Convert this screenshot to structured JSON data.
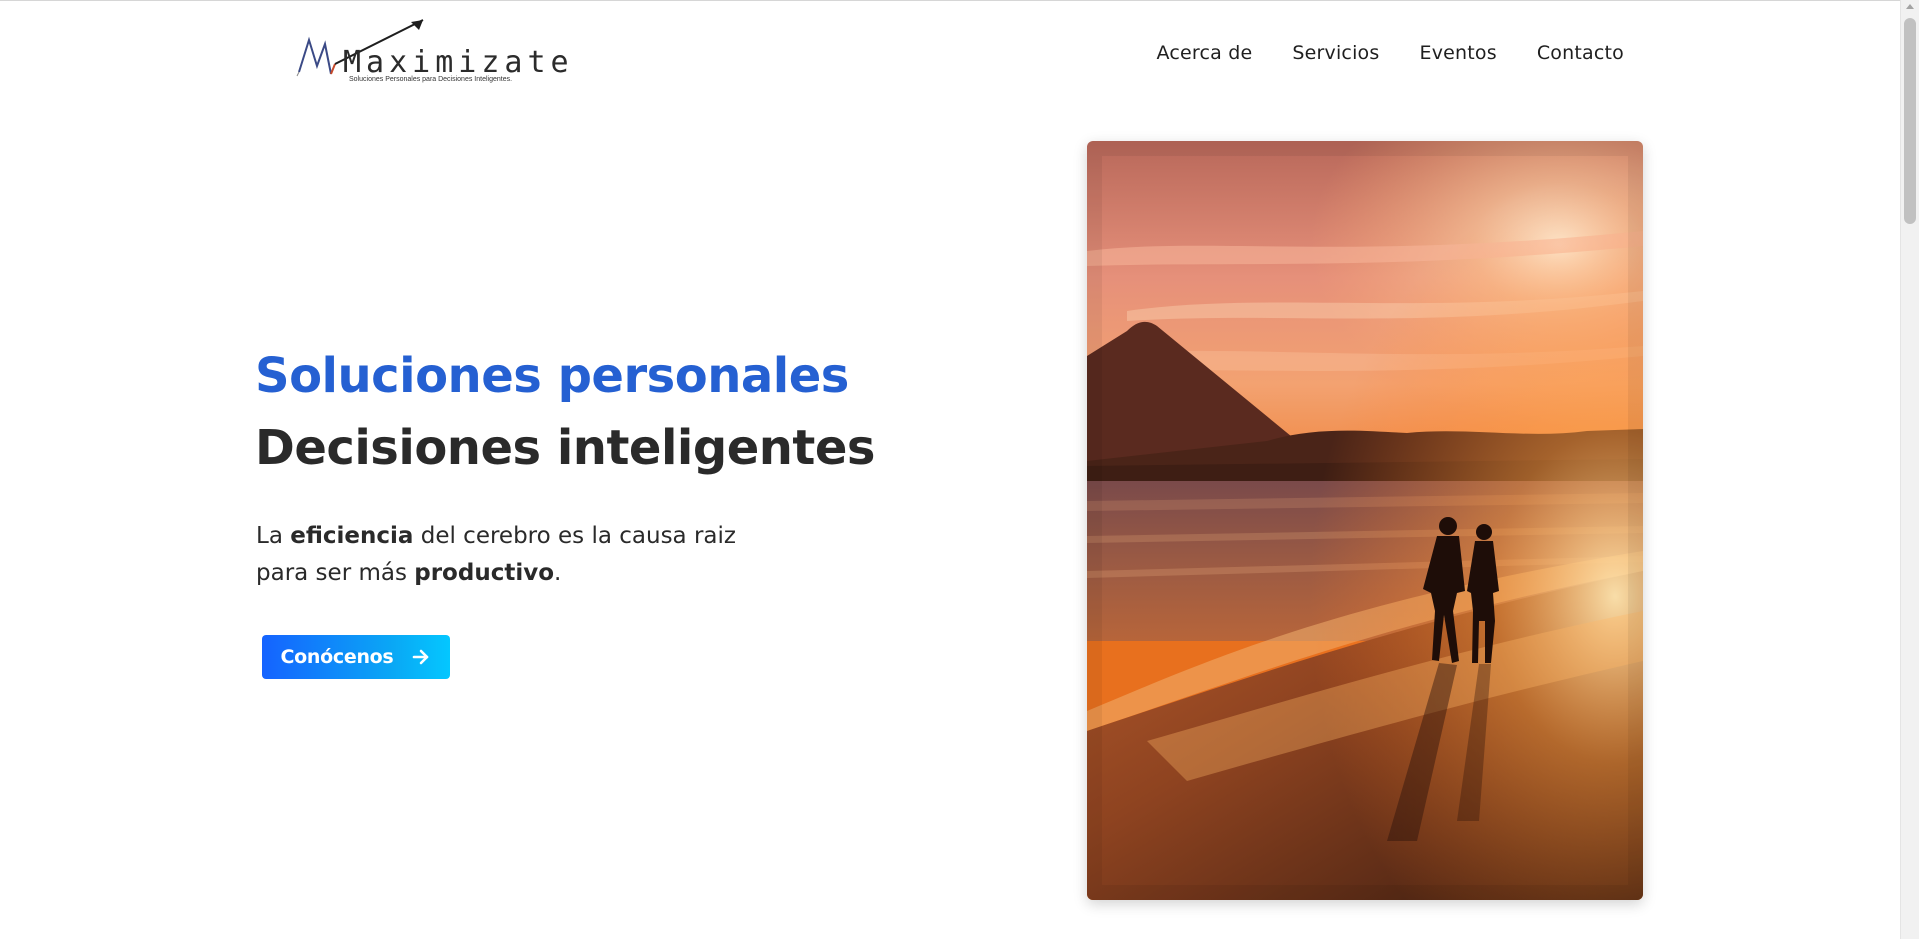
{
  "header": {
    "logo": {
      "wordmark": "Maximizate",
      "tagline": "Soluciones Personales para Decisiones Inteligentes."
    },
    "nav": [
      {
        "label": "Acerca de"
      },
      {
        "label": "Servicios"
      },
      {
        "label": "Eventos"
      },
      {
        "label": "Contacto"
      }
    ]
  },
  "hero": {
    "title_line1": "Soluciones personales",
    "title_line2": "Decisiones inteligentes",
    "paragraph": {
      "p1": "La ",
      "bold1": "eficiencia",
      "p2": " del cerebro es la causa raiz",
      "p3": "para ser más ",
      "bold2": "productivo",
      "p4": "."
    },
    "cta_label": "Conócenos",
    "cta_icon": "arrow-right-icon"
  },
  "colors": {
    "accent_blue": "#2560d2",
    "heading_dark": "#2a2a2a",
    "cta_gradient_start": "#1563ff",
    "cta_gradient_end": "#04c7ff"
  }
}
